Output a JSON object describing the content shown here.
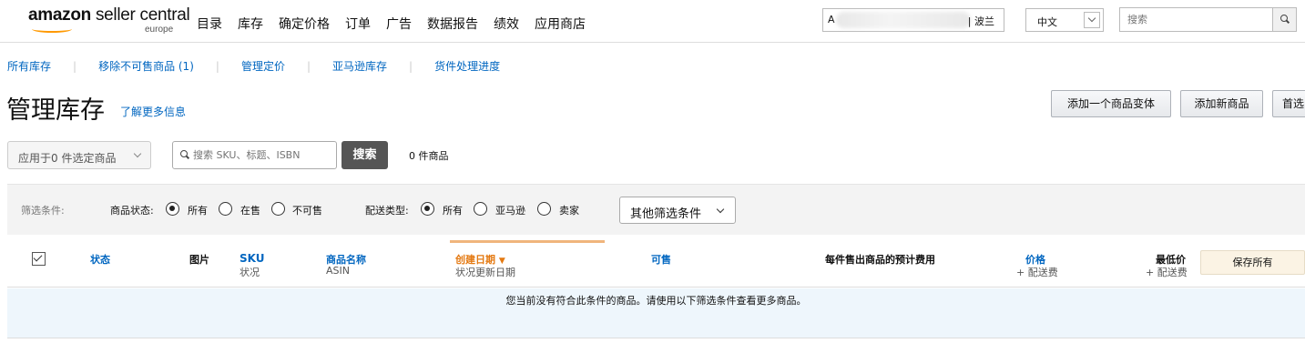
{
  "header": {
    "logo_brand": "amazon",
    "logo_product": "seller central",
    "logo_region": "europe",
    "nav": [
      "目录",
      "库存",
      "确定价格",
      "订单",
      "广告",
      "数据报告",
      "绩效",
      "应用商店"
    ],
    "account_prefix": "A",
    "account_region": "| 波兰",
    "language": "中文",
    "search_placeholder": "搜索"
  },
  "subnav": [
    "所有库存",
    "移除不可售商品 (1)",
    "管理定价",
    "亚马逊库存",
    "货件处理进度"
  ],
  "page": {
    "title": "管理库存",
    "learn_more": "了解更多信息",
    "buttons": {
      "add_variation": "添加一个商品变体",
      "add_product": "添加新商品",
      "preferences": "首选"
    }
  },
  "search_row": {
    "apply_to": "应用于0 件选定商品",
    "search_placeholder": "搜索 SKU、标题、ISBN",
    "search_button": "搜索",
    "result_count": "0 件商品"
  },
  "filters": {
    "label": "筛选条件:",
    "status_label": "商品状态:",
    "status_options": [
      "所有",
      "在售",
      "不可售"
    ],
    "status_selected": 0,
    "fulfillment_label": "配送类型:",
    "fulfillment_options": [
      "所有",
      "亚马逊",
      "卖家"
    ],
    "fulfillment_selected": 0,
    "more_filters": "其他筛选条件"
  },
  "table": {
    "columns": {
      "status": "状态",
      "image": "图片",
      "sku": "SKU",
      "sku_sub": "状况",
      "name": "商品名称",
      "name_sub": "ASIN",
      "created": "创建日期",
      "created_sub": "状况更新日期",
      "available": "可售",
      "fee": "每件售出商品的预计费用",
      "price": "价格",
      "price_sub": "+ 配送费",
      "lowest": "最低价",
      "lowest_sub": "+ 配送费"
    },
    "save_all": "保存所有",
    "empty_message": "您当前没有符合此条件的商品。请使用以下筛选条件查看更多商品。"
  },
  "colors": {
    "link": "#0066c0",
    "sort_accent": "#e47911",
    "logo_smile": "#ff9900",
    "empty_row_bg": "#eef6fc",
    "filter_bar_bg": "#f3f3f3"
  },
  "icons": [
    "search-icon",
    "chevron-down-icon",
    "checkbox-icon",
    "sort-down-icon"
  ]
}
